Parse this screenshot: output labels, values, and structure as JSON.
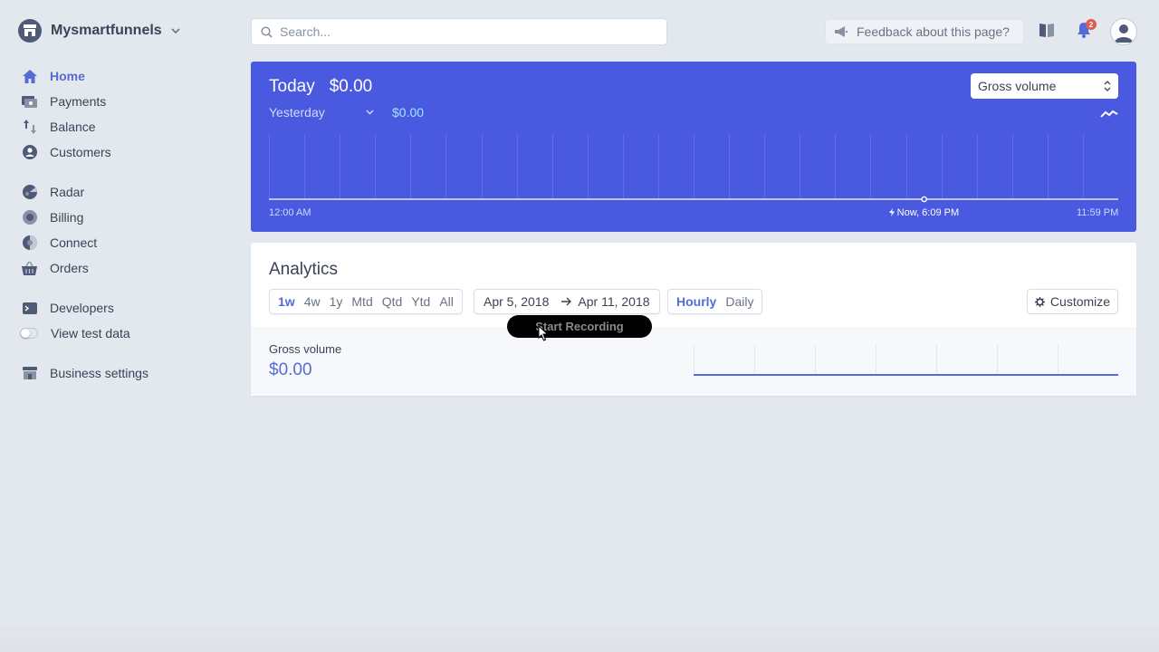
{
  "brand": {
    "name": "Mysmartfunnels"
  },
  "nav": {
    "home": "Home",
    "payments": "Payments",
    "balance": "Balance",
    "customers": "Customers",
    "radar": "Radar",
    "billing": "Billing",
    "connect": "Connect",
    "orders": "Orders",
    "developers": "Developers",
    "test_data": "View test data",
    "business_settings": "Business settings"
  },
  "search": {
    "placeholder": "Search..."
  },
  "feedback": {
    "label": "Feedback about this page?"
  },
  "notifications": {
    "count": "2"
  },
  "today": {
    "title": "Today",
    "amount": "$0.00",
    "compare_label": "Yesterday",
    "compare_amount": "$0.00",
    "metric_select": "Gross volume",
    "axis_start": "12:00 AM",
    "axis_now": "Now, 6:09 PM",
    "axis_end": "11:59 PM",
    "now_fraction": 0.7715
  },
  "analytics": {
    "title": "Analytics",
    "ranges": [
      "1w",
      "4w",
      "1y",
      "Mtd",
      "Qtd",
      "Ytd",
      "All"
    ],
    "selected_range": "1w",
    "date_start": "Apr 5, 2018",
    "date_end": "Apr 11, 2018",
    "intervals": [
      "Hourly",
      "Daily"
    ],
    "selected_interval": "Hourly",
    "customize_label": "Customize",
    "metric_label": "Gross volume",
    "metric_amount": "$0.00"
  },
  "overlay": {
    "recording_label": "Start Recording"
  },
  "colors": {
    "accent": "#556cd6",
    "today_bg": "#4a5ae0",
    "page_bg": "#e3e8ee"
  }
}
